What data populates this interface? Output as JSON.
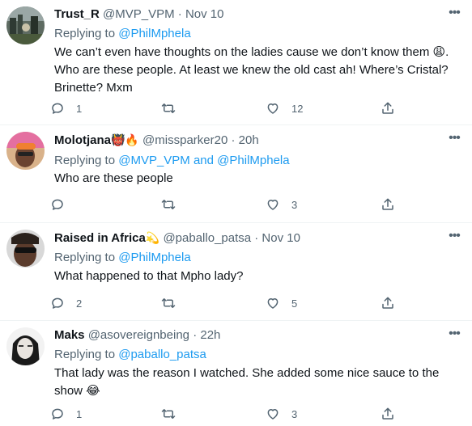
{
  "tweets": [
    {
      "name": "Trust_R",
      "name_emoji": "",
      "handle": "@MVP_VPM",
      "dot": "·",
      "time": "Nov 10",
      "replying_prefix": "Replying to",
      "replying_to": "@PhilMphela",
      "body_lines": [
        "We can’t even have thoughts on the ladies cause we don’t know them 😩.",
        "Who are these people. At least we knew the old cast ah! Where’s Cristal?",
        "Brinette? Mxm"
      ],
      "counts": {
        "reply": "1",
        "retweet": "",
        "like": "12"
      }
    },
    {
      "name": "Molotjana",
      "name_emoji": "👹🔥",
      "handle": "@missparker20",
      "dot": "·",
      "time": "20h",
      "replying_prefix": "Replying to",
      "replying_to": "@MVP_VPM and @PhilMphela",
      "body_lines": [
        "Who are these people"
      ],
      "counts": {
        "reply": "",
        "retweet": "",
        "like": "3"
      }
    },
    {
      "name": "Raised in Africa",
      "name_emoji": "💫",
      "handle": "@paballo_patsa",
      "dot": "·",
      "time": "Nov 10",
      "replying_prefix": "Replying to",
      "replying_to": "@PhilMphela",
      "body_lines": [
        "What happened to that Mpho lady?"
      ],
      "counts": {
        "reply": "2",
        "retweet": "",
        "like": "5"
      }
    },
    {
      "name": "Maks",
      "name_emoji": "",
      "handle": "@asovereignbeing",
      "dot": "·",
      "time": "22h",
      "replying_prefix": "Replying to",
      "replying_to": "@paballo_patsa",
      "body_lines": [
        "That lady was the reason I watched. She added some nice sauce to the",
        "show 😂"
      ],
      "counts": {
        "reply": "1",
        "retweet": "",
        "like": "3"
      }
    }
  ],
  "icons": {
    "more": "more-horizontal-icon",
    "reply": "reply-bubble-icon",
    "retweet": "retweet-icon",
    "like": "heart-icon",
    "share": "share-icon"
  },
  "colors": {
    "link": "#1d9bf0",
    "secondary": "#536471",
    "text": "#0f1419",
    "divider": "#eff3f4"
  }
}
